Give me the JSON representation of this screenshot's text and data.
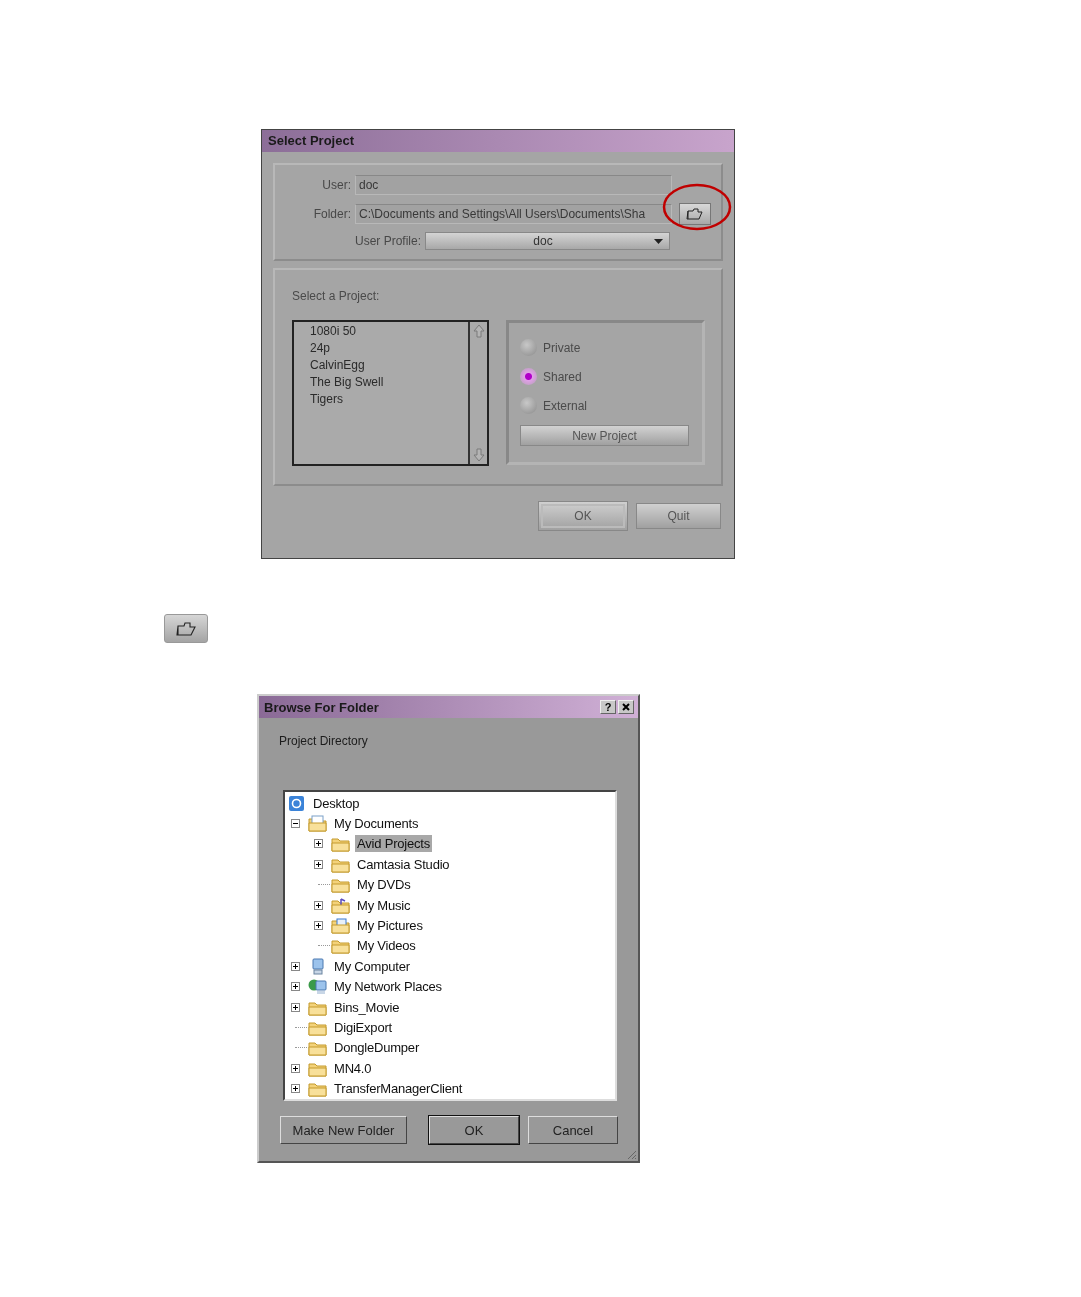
{
  "select_project": {
    "title": "Select Project",
    "user": {
      "label": "User:",
      "value": "doc"
    },
    "folder": {
      "label": "Folder:",
      "value": "C:\\Documents and Settings\\All Users\\Documents\\Sha"
    },
    "user_profile": {
      "label": "User Profile:",
      "value": "doc"
    },
    "projects_label": "Select a Project:",
    "projects": [
      "1080i 50",
      "24p",
      "CalvinEgg",
      "The Big Swell",
      "Tigers"
    ],
    "locations": [
      {
        "label": "Private",
        "selected": false
      },
      {
        "label": "Shared",
        "selected": true
      },
      {
        "label": "External",
        "selected": false
      }
    ],
    "new_project": "New Project",
    "buttons": [
      {
        "label": "OK",
        "default": true
      },
      {
        "label": "Quit",
        "default": false
      }
    ]
  },
  "browse": {
    "title": "Browse For Folder",
    "help": "?",
    "prompt": "Project Directory",
    "tree": [
      {
        "label": "Desktop",
        "kind": "desktop",
        "selected": false
      },
      {
        "label": "My Documents",
        "kind": "documents",
        "selected": false,
        "expanded": true,
        "children": [
          {
            "label": "Avid Projects",
            "kind": "folder",
            "selected": true,
            "expanded": false
          },
          {
            "label": "Camtasia Studio",
            "kind": "folder",
            "selected": false,
            "expanded": false
          },
          {
            "label": "My DVDs",
            "kind": "folder",
            "selected": false
          },
          {
            "label": "My Music",
            "kind": "music",
            "selected": false,
            "expanded": false
          },
          {
            "label": "My Pictures",
            "kind": "pictures",
            "selected": false,
            "expanded": false
          },
          {
            "label": "My Videos",
            "kind": "folder",
            "selected": false
          }
        ]
      },
      {
        "label": "My Computer",
        "kind": "computer",
        "selected": false,
        "expanded": false
      },
      {
        "label": "My Network Places",
        "kind": "network",
        "selected": false,
        "expanded": false
      },
      {
        "label": "Bins_Movie",
        "kind": "folder",
        "selected": false,
        "expanded": false
      },
      {
        "label": "DigiExport",
        "kind": "folder",
        "selected": false
      },
      {
        "label": "DongleDumper",
        "kind": "folder",
        "selected": false
      },
      {
        "label": "MN4.0",
        "kind": "folder",
        "selected": false,
        "expanded": false
      },
      {
        "label": "TransferManagerClient",
        "kind": "folder",
        "selected": false,
        "expanded": false
      }
    ],
    "buttons": [
      {
        "label": "Make New Folder",
        "default": false
      },
      {
        "label": "OK",
        "default": true
      },
      {
        "label": "Cancel",
        "default": false
      }
    ]
  }
}
